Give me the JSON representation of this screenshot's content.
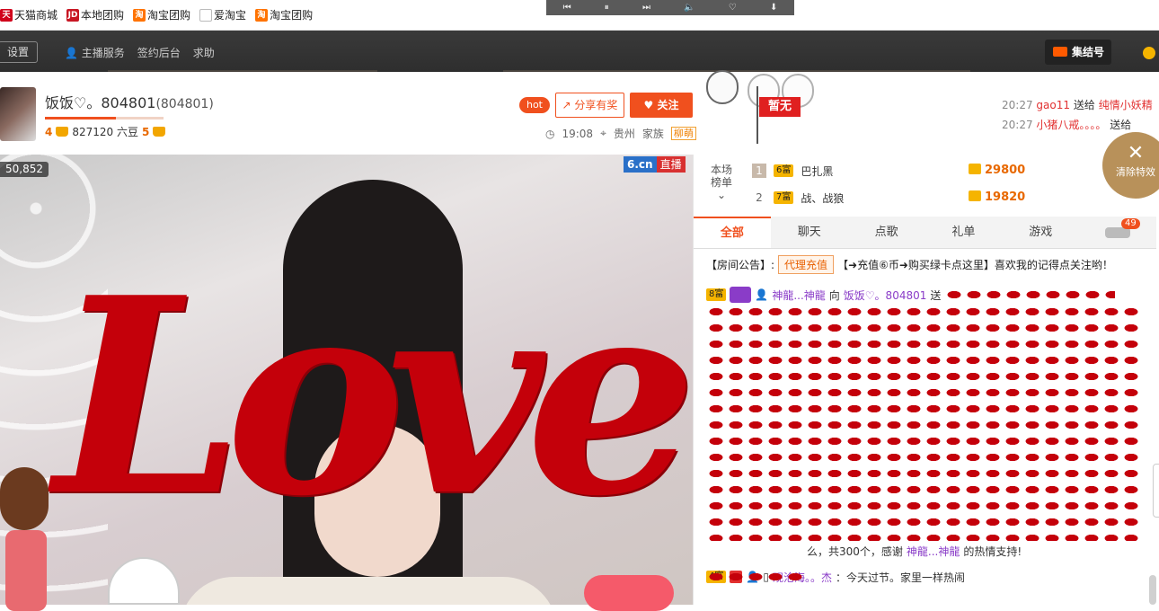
{
  "bookmarks": [
    {
      "label": "天猫商城",
      "icon": "tmall-icon",
      "glyph": "天"
    },
    {
      "label": "本地团购",
      "icon": "jd-icon",
      "glyph": "JD"
    },
    {
      "label": "淘宝团购",
      "icon": "taobao-icon",
      "glyph": "淘"
    },
    {
      "label": "爱淘宝",
      "icon": "doc-icon",
      "glyph": ""
    },
    {
      "label": "淘宝团购",
      "icon": "taobao-icon",
      "glyph": "淘"
    }
  ],
  "topnav": {
    "settings": "设置",
    "links": [
      "主播服务",
      "签约后台",
      "求助"
    ],
    "rally": "集结号"
  },
  "anchor": {
    "name": "饭饭♡。804801",
    "room_id": "(804801)",
    "level_left": "4",
    "beans": "827120 六豆",
    "level_right": "5",
    "hot": "hot",
    "share": "分享有奖",
    "follow": "关注",
    "time": "19:08",
    "location": "贵州",
    "family_label": "家族",
    "family_tag": "柳萌"
  },
  "zanwu": "暂无",
  "gift_feed": [
    {
      "time": "20:27",
      "user": "gao11",
      "action": "送给",
      "target": "纯情小妖精"
    },
    {
      "time": "20:27",
      "user": "小猪八戒。。。。",
      "action": "送给",
      "target": ""
    }
  ],
  "video": {
    "viewers": "50,852",
    "logo": "6.cn",
    "live": "直播",
    "overlay_text": "Love"
  },
  "rank": {
    "label": "本场榜单",
    "rows": [
      {
        "no": "1",
        "badge": "6富",
        "name": "巴扎黑",
        "value": "29800"
      },
      {
        "no": "2",
        "badge": "7富",
        "name": "战、战狼",
        "value": "19820"
      }
    ]
  },
  "clear_effects": "清除特效",
  "tabs": [
    "全部",
    "聊天",
    "点歌",
    "礼单",
    "游戏"
  ],
  "tab_badge": "49",
  "notice": {
    "label": "【房间公告】:",
    "button": "代理充值",
    "text": "【➜充值⑥币➜购买绿卡点这里】喜欢我的记得点关注哟！"
  },
  "chat": {
    "gift_user_badge": "8富",
    "gift_user": "神龍...神龍",
    "to": "向",
    "anchor": "饭饭♡。804801",
    "send": "送",
    "thanks_prefix": "么，共300个，感谢",
    "thanks_user": "神龍...神龍",
    "thanks_suffix": "的热情支持!",
    "msg_badge": "4富",
    "msg_user": "观沧海。。杰",
    "msg_text": "：今天过节。家里一样热闹"
  }
}
